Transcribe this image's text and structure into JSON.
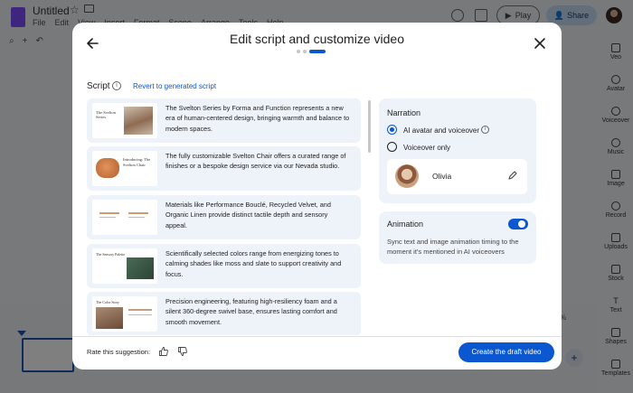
{
  "app": {
    "title": "Untitled",
    "menu": [
      "File",
      "Edit",
      "View",
      "Insert",
      "Format",
      "Scene",
      "Arrange",
      "Tools",
      "Help"
    ],
    "play_label": "Play",
    "share_label": "Share",
    "zoom": "%",
    "rail": [
      "Veo",
      "Avatar",
      "Voiceover",
      "Music",
      "Image",
      "Record",
      "Uploads",
      "Stock",
      "Text",
      "Shapes",
      "Templates"
    ]
  },
  "modal": {
    "title": "Edit script and customize video",
    "step_current": 3,
    "step_total": 3,
    "script_label": "Script",
    "revert_label": "Revert to generated script",
    "scenes": [
      {
        "text": "The Svelton Series by Forma and Function represents a new era of human-centered design, bringing warmth and balance to modern spaces.",
        "thumb_caption": "The Svelton Series"
      },
      {
        "text": "The fully customizable Svelton Chair offers a curated range of finishes or a bespoke design service via our Nevada studio.",
        "thumb_caption": "Introducing: The Svelton Chair"
      },
      {
        "text": "Materials like Performance Bouclé, Recycled Velvet, and Organic Linen provide distinct tactile depth and sensory appeal.",
        "thumb_caption": ""
      },
      {
        "text": "Scientifically selected colors range from energizing tones to calming shades like moss and slate to support creativity and focus.",
        "thumb_caption": "The Sensory Palette"
      },
      {
        "text": "Precision engineering, featuring high-resiliency foam and a silent 360-degree swivel base, ensures lasting comfort and smooth movement.",
        "thumb_caption": "The Color Story"
      }
    ],
    "narration": {
      "title": "Narration",
      "option_avatar": "AI avatar and voiceover",
      "option_voice": "Voiceover only",
      "voice_name": "Olivia"
    },
    "animation": {
      "title": "Animation",
      "enabled": true,
      "description": "Sync text and image animation timing to the moment it's mentioned in AI voiceovers"
    },
    "rate_label": "Rate this suggestion:",
    "create_label": "Create the draft video"
  },
  "colors": {
    "accent": "#0b57d0",
    "card_bg": "#eef2f9",
    "brand": "#7c4dff"
  }
}
